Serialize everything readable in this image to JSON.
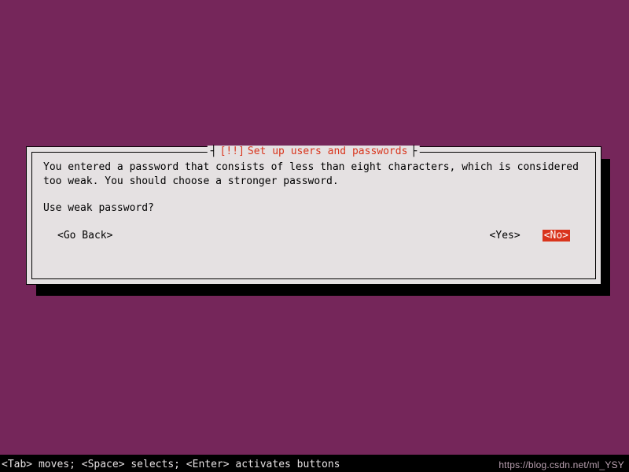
{
  "dialog": {
    "title_prefix": "[!!]",
    "title_text": "Set up users and passwords",
    "body": "You entered a password that consists of less than eight characters, which is considered too weak. You should choose a stronger password.",
    "question": "Use weak password?",
    "go_back": "<Go Back>",
    "yes": "<Yes>",
    "no": "<No>"
  },
  "footer": {
    "hint": "<Tab> moves; <Space> selects; <Enter> activates buttons",
    "watermark": "https://blog.csdn.net/ml_YSY"
  },
  "colors": {
    "background": "#75265a",
    "panel": "#e5e1e2",
    "accent": "#d9341c"
  }
}
